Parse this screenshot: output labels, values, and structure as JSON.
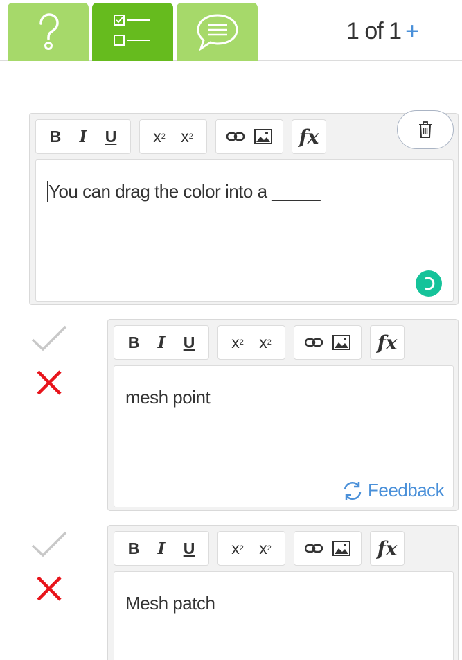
{
  "tabs": [
    {
      "name": "help",
      "icon": "question-mark-icon"
    },
    {
      "name": "options",
      "icon": "checklist-icon",
      "active": true
    },
    {
      "name": "comment",
      "icon": "speech-bubble-icon"
    }
  ],
  "counter": {
    "text": "1 of 1",
    "plus": "+"
  },
  "toolbar": {
    "bold": "B",
    "italic": "I",
    "underline": "U",
    "superscript": "x",
    "subscript": "x",
    "sup_mark": "2",
    "sub_mark": "2",
    "formula": "fx"
  },
  "question": {
    "text": "You can drag the color into a _____"
  },
  "answers": [
    {
      "text": "mesh point",
      "feedback_label": "Feedback"
    },
    {
      "text": "Mesh patch"
    }
  ],
  "colors": {
    "tab": "#a6d96a",
    "tab_active": "#66bb1e",
    "accent_blue": "#4a90d9",
    "wrong_red": "#e8141b",
    "check_gray": "#c8c8c8",
    "grammarly_green": "#15c39a"
  }
}
